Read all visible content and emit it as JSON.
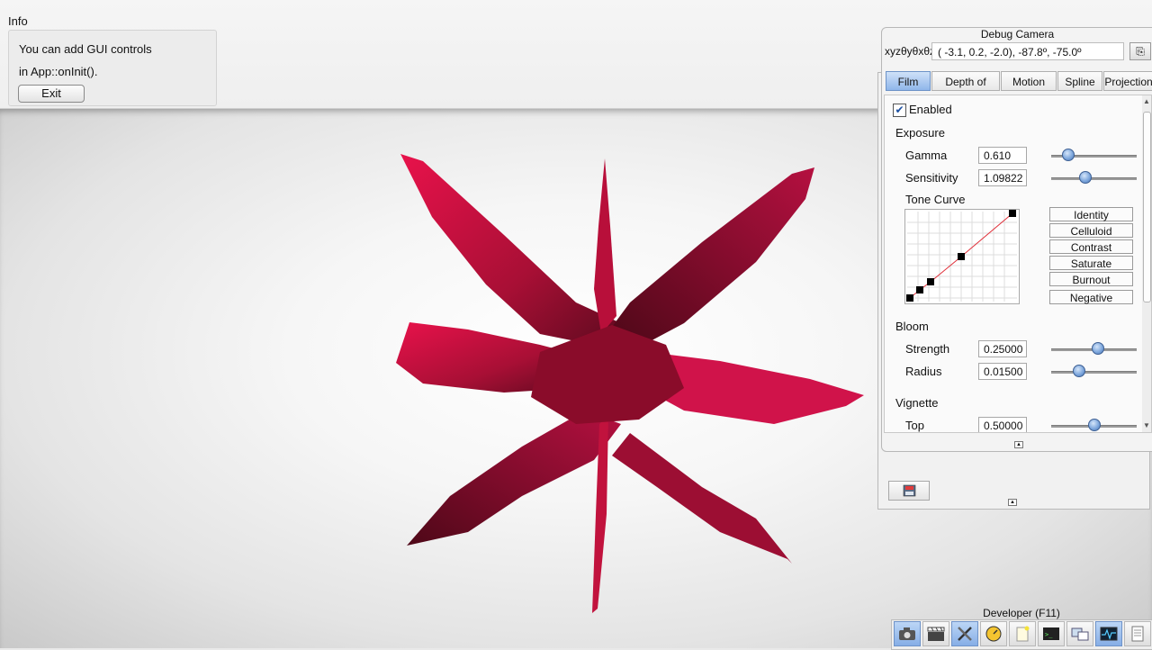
{
  "info": {
    "title": "Info",
    "line1": "You can add GUI controls",
    "line2": "in App::onInit().",
    "exit_label": "Exit"
  },
  "debug_camera": {
    "title": "Debug Camera",
    "coord_label": "xyzθyθxθz",
    "coord_value": "( -3.1,   0.2,  -2.0), -87.8º, -75.0º",
    "tabs": [
      {
        "label": "Film",
        "active": true
      },
      {
        "label": "Depth of Field",
        "active": false
      },
      {
        "label": "Motion Blur",
        "active": false
      },
      {
        "label": "Spline",
        "active": false
      },
      {
        "label": "Projection",
        "active": false
      }
    ],
    "film": {
      "enabled_label": "Enabled",
      "enabled": true,
      "exposure_label": "Exposure",
      "gamma_label": "Gamma",
      "gamma_value": "0.610",
      "gamma_slider": 0.2,
      "sensitivity_label": "Sensitivity",
      "sensitivity_value": "1.09822",
      "sensitivity_slider": 0.4,
      "tone_curve_label": "Tone Curve",
      "presets": [
        "Identity",
        "Celluloid",
        "Contrast",
        "Saturate",
        "Burnout",
        "Negative"
      ],
      "bloom_label": "Bloom",
      "strength_label": "Strength",
      "strength_value": "0.25000",
      "strength_slider": 0.55,
      "radius_label": "Radius",
      "radius_value": "0.01500",
      "radius_slider": 0.33,
      "vignette_label": "Vignette",
      "top_label": "Top",
      "top_value": "0.50000",
      "top_slider": 0.5
    }
  },
  "developer": {
    "title": "Developer (F11)",
    "buttons": [
      "camera-icon",
      "clapperboard-icon",
      "tools-icon",
      "speedometer-icon",
      "note-icon",
      "terminal-icon",
      "windows-icon",
      "profiler-icon",
      "document-icon"
    ]
  },
  "colors": {
    "accent": "#86aee6",
    "shape": "#c0143a"
  }
}
